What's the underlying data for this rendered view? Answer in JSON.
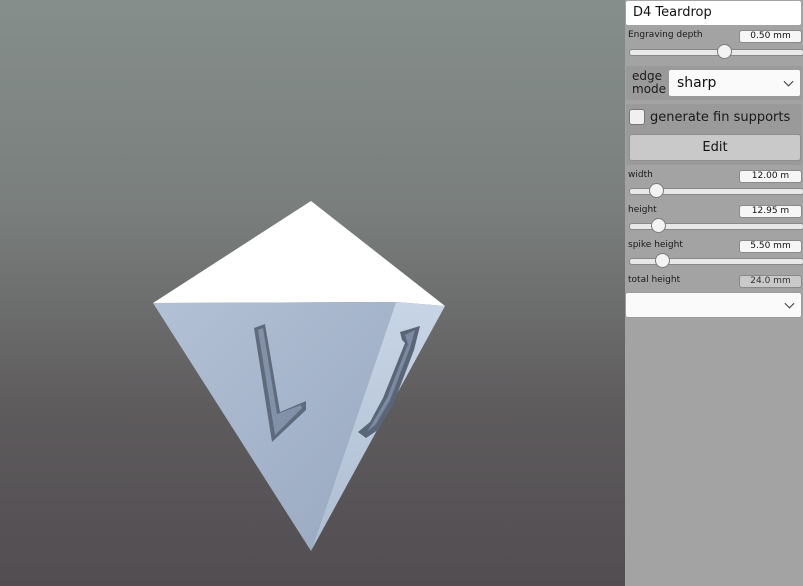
{
  "model": {
    "face_numerals": [
      "L",
      "Z"
    ],
    "colors": {
      "top_face": "#ffffff",
      "front_face": "#a8b7cd",
      "right_face": "#bfcde0"
    }
  },
  "panel": {
    "title": "D4 Teardrop",
    "engraving": {
      "label": "Engraving depth",
      "value": "0.50 mm",
      "slider_fraction": 0.55
    },
    "edge_mode": {
      "label": "edge mode",
      "selected": "sharp"
    },
    "fin_supports": {
      "label": "generate fin supports",
      "checked": false
    },
    "edit_button": "Edit",
    "width": {
      "label": "width",
      "value": "12.00 m",
      "slider_fraction": 0.12
    },
    "height": {
      "label": "height",
      "value": "12.95 m",
      "slider_fraction": 0.13
    },
    "spike_height": {
      "label": "spike height",
      "value": "5.50 mm",
      "slider_fraction": 0.16
    },
    "total_height": {
      "label": "total height",
      "value": "24.0 mm"
    },
    "bottom_dropdown": {
      "selected": ""
    }
  }
}
